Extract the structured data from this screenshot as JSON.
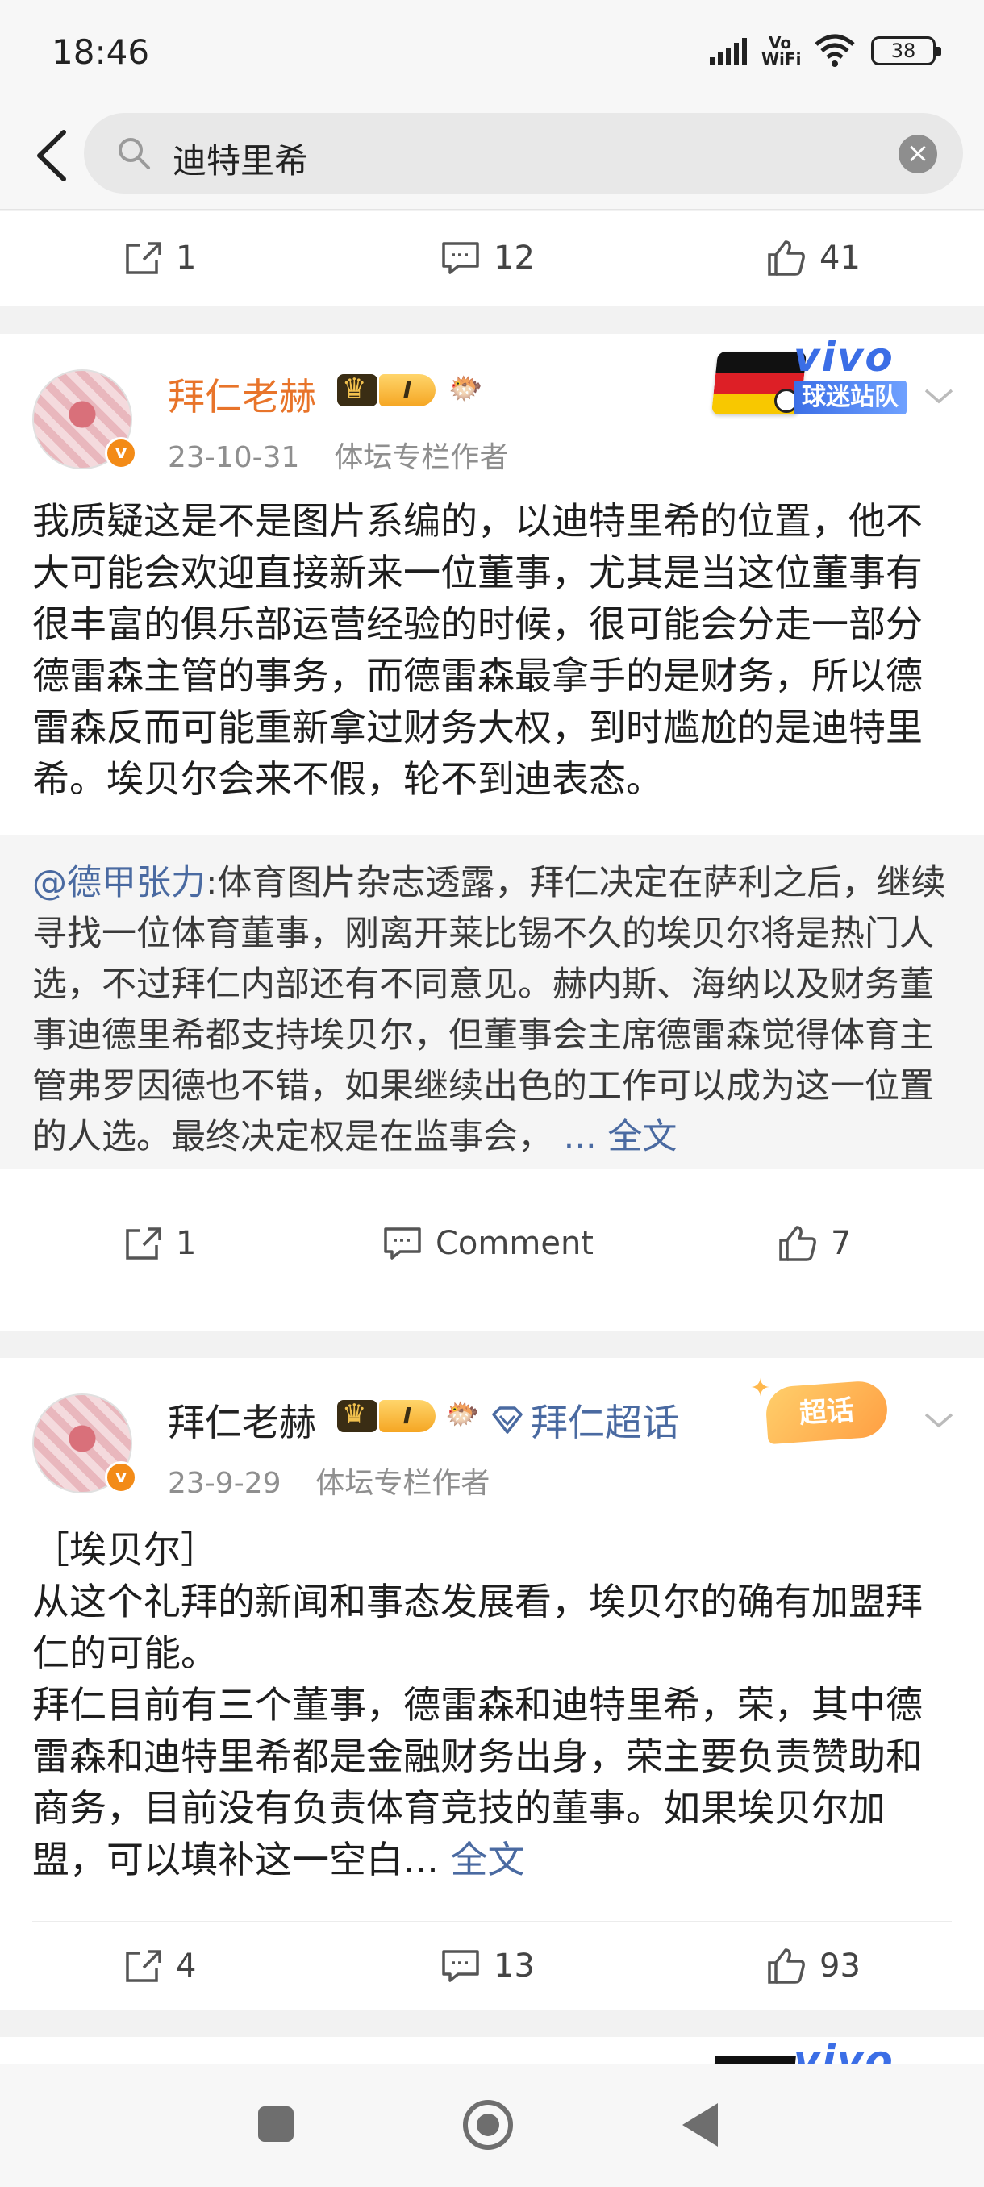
{
  "status": {
    "time": "18:46",
    "network": "Vo WiFi",
    "battery": "38"
  },
  "search": {
    "query": "迪特里希"
  },
  "post0_actions": {
    "repost": "1",
    "comment": "12",
    "like": "41"
  },
  "post1": {
    "username": "拜仁老赫",
    "level": "I",
    "date": "23-10-31",
    "source": "体坛专栏作者",
    "brand": {
      "name": "vivo",
      "team": "球迷站队"
    },
    "text": "我质疑这是不是图片系编的，以迪特里希的位置，他不大可能会欢迎直接新来一位董事，尤其是当这位董事有很丰富的俱乐部运营经验的时候，很可能会分走一部分德雷森主管的事务，而德雷森最拿手的是财务，所以德雷森反而可能重新拿过财务大权，到时尴尬的是迪特里希。埃贝尔会来不假，轮不到迪表态。",
    "quote": {
      "mention": "@德甲张力",
      "text": ":体育图片杂志透露，拜仁决定在萨利之后，继续寻找一位体育董事，刚离开莱比锡不久的埃贝尔将是热门人选，不过拜仁内部还有不同意见。赫内斯、海纳以及财务董事迪德里希都支持埃贝尔，但董事会主席德雷森觉得体育主管弗罗因德也不错，如果继续出色的工作可以成为这一位置的人选。最终决定权是在监事会，",
      "more": " ... 全文"
    },
    "actions": {
      "repost": "1",
      "comment": "Comment",
      "like": "7"
    }
  },
  "post2": {
    "username": "拜仁老赫",
    "level": "I",
    "topic": "拜仁超话",
    "badge": "超话",
    "date": "23-9-29",
    "source": "体坛专栏作者",
    "text": "［埃贝尔］\n从这个礼拜的新闻和事态发展看，埃贝尔的确有加盟拜仁的可能。\n拜仁目前有三个董事，德雷森和迪特里希，荣，其中德雷森和迪特里希都是金融财务出身，荣主要负责赞助和商务，目前没有负责体育竞技的董事。如果埃贝尔加盟，可以填补这一空白...",
    "more": " 全文",
    "actions": {
      "repost": "4",
      "comment": "13",
      "like": "93"
    }
  },
  "post3_peek": {
    "brand": "vivo"
  },
  "colors": {
    "accent_orange": "#e8742a",
    "link_blue": "#4a6aa1",
    "vivo_blue": "#3b6ee6"
  }
}
